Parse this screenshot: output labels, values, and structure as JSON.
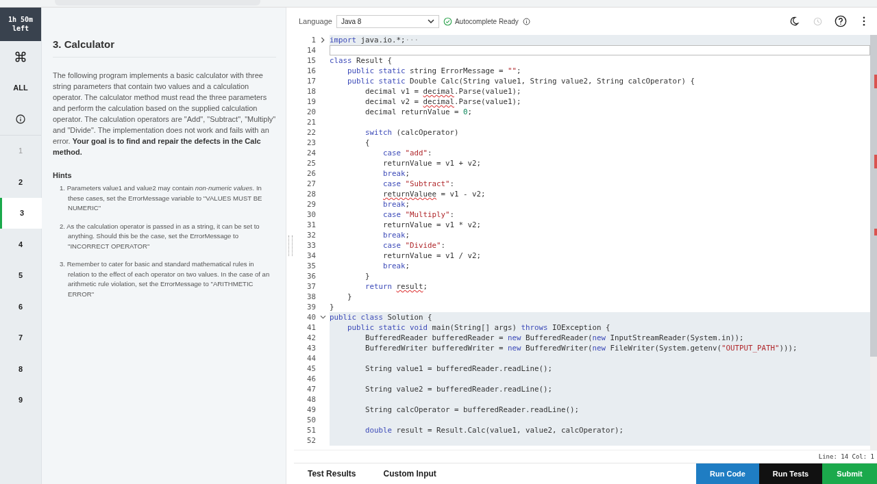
{
  "timer": {
    "text": "1h 50m\nleft"
  },
  "rail": [
    {
      "kind": "command",
      "selected": false
    },
    {
      "kind": "text",
      "label": "ALL",
      "selected": false
    },
    {
      "kind": "info",
      "selected": false
    },
    {
      "kind": "number",
      "label": "1",
      "selected": false,
      "done": true
    },
    {
      "kind": "number",
      "label": "2",
      "selected": false,
      "done": false
    },
    {
      "kind": "number",
      "label": "3",
      "selected": true,
      "done": false
    },
    {
      "kind": "number",
      "label": "4",
      "selected": false,
      "done": false
    },
    {
      "kind": "number",
      "label": "5",
      "selected": false,
      "done": false
    },
    {
      "kind": "number",
      "label": "6",
      "selected": false,
      "done": false
    },
    {
      "kind": "number",
      "label": "7",
      "selected": false,
      "done": false
    },
    {
      "kind": "number",
      "label": "8",
      "selected": false,
      "done": false
    },
    {
      "kind": "number",
      "label": "9",
      "selected": false,
      "done": false
    }
  ],
  "problem": {
    "title": "3. Calculator",
    "description": "The following program implements a basic calculator with three string parameters that contain two values and a calculation operator. The calculator method must read the three parameters and perform the calculation based on the supplied calculation operator. The calculation operators are \"Add\", \"Subtract\", \"Multiply\" and \"Divide\". The implementation does not work and fails with an error. **Your goal is to find and repair the defects in the Calc method.**",
    "hints_heading": "Hints",
    "hints": [
      "1. Parameters value1 and value2 may contain *non-numeric values*. In these cases, set the ErrorMessage variable to \"VALUES MUST BE NUMERIC\"",
      "2. As the calculation operator is passed in as a string, it can be set to anything. Should this be the case, set the ErrorMessage  to \"INCORRECT OPERATOR\"",
      "3. Remember to cater for basic and standard mathematical rules in relation to the effect of each operator on two values. In the case of an arithmetic rule violation, set the ErrorMessage to \"ARITHMETIC ERROR\""
    ]
  },
  "toolbar": {
    "language_label": "Language",
    "language": "Java 8",
    "autocomplete": "Autocomplete Ready"
  },
  "code": [
    {
      "n": "1",
      "collapsed": true,
      "selected": true,
      "current": false,
      "segs": [
        {
          "kind": "kw",
          "t": "import"
        },
        {
          "kind": "plain",
          "t": " java.io.*;"
        },
        {
          "kind": "fold",
          "t": "···"
        }
      ]
    },
    {
      "n": "14",
      "selected": false,
      "current": true
    },
    {
      "n": "15",
      "selected": false,
      "current": false,
      "segs": [
        {
          "kind": "kw",
          "t": "class"
        },
        {
          "kind": "plain",
          "t": " Result {"
        }
      ]
    },
    {
      "n": "16",
      "selected": false,
      "current": false,
      "segs": [
        {
          "kind": "kw",
          "t": "    public static"
        },
        {
          "kind": "plain",
          "t": " string ErrorMessage = "
        },
        {
          "kind": "str",
          "t": "\"\""
        },
        {
          "kind": "plain",
          "t": ";"
        }
      ]
    },
    {
      "n": "17",
      "selected": false,
      "current": false,
      "segs": [
        {
          "kind": "kw",
          "t": "    public static"
        },
        {
          "kind": "plain",
          "t": " Double Calc(String value1, String value2, String calcOperator) {"
        }
      ]
    },
    {
      "n": "18",
      "selected": false,
      "current": false,
      "segs": [
        {
          "kind": "plain",
          "t": "        decimal v1 = "
        },
        {
          "kind": "err",
          "t": "decimal"
        },
        {
          "kind": "plain",
          "t": ".Parse(value1);"
        }
      ]
    },
    {
      "n": "19",
      "selected": false,
      "current": false,
      "segs": [
        {
          "kind": "plain",
          "t": "        decimal v2 = "
        },
        {
          "kind": "err",
          "t": "decimal"
        },
        {
          "kind": "plain",
          "t": ".Parse(value1);"
        }
      ]
    },
    {
      "n": "20",
      "selected": false,
      "current": false,
      "segs": [
        {
          "kind": "plain",
          "t": "        decimal returnValue = "
        },
        {
          "kind": "num",
          "t": "0"
        },
        {
          "kind": "plain",
          "t": ";"
        }
      ]
    },
    {
      "n": "21",
      "selected": false,
      "current": false
    },
    {
      "n": "22",
      "selected": false,
      "current": false,
      "segs": [
        {
          "kind": "kw",
          "t": "        switch"
        },
        {
          "kind": "plain",
          "t": " (calcOperator)"
        }
      ]
    },
    {
      "n": "23",
      "selected": false,
      "current": false,
      "segs": [
        {
          "kind": "plain",
          "t": "        {"
        }
      ]
    },
    {
      "n": "24",
      "selected": false,
      "current": false,
      "segs": [
        {
          "kind": "kw",
          "t": "            case"
        },
        {
          "kind": "str",
          "t": " \"add\""
        },
        {
          "kind": "plain",
          "t": ":"
        }
      ]
    },
    {
      "n": "25",
      "selected": false,
      "current": false,
      "segs": [
        {
          "kind": "plain",
          "t": "            returnValue = v1 + v2;"
        }
      ]
    },
    {
      "n": "26",
      "selected": false,
      "current": false,
      "segs": [
        {
          "kind": "kw",
          "t": "            break"
        },
        {
          "kind": "plain",
          "t": ";"
        }
      ]
    },
    {
      "n": "27",
      "selected": false,
      "current": false,
      "segs": [
        {
          "kind": "kw",
          "t": "            case"
        },
        {
          "kind": "str",
          "t": " \"Subtract\""
        },
        {
          "kind": "plain",
          "t": ":"
        }
      ]
    },
    {
      "n": "28",
      "selected": false,
      "current": false,
      "segs": [
        {
          "kind": "err",
          "t": "            returnValuee"
        },
        {
          "kind": "plain",
          "t": " = v1 - v2;"
        }
      ]
    },
    {
      "n": "29",
      "selected": false,
      "current": false,
      "segs": [
        {
          "kind": "kw",
          "t": "            break"
        },
        {
          "kind": "plain",
          "t": ";"
        }
      ]
    },
    {
      "n": "30",
      "selected": false,
      "current": false,
      "segs": [
        {
          "kind": "kw",
          "t": "            case"
        },
        {
          "kind": "str",
          "t": " \"Multiply\""
        },
        {
          "kind": "plain",
          "t": ":"
        }
      ]
    },
    {
      "n": "31",
      "selected": false,
      "current": false,
      "segs": [
        {
          "kind": "plain",
          "t": "            returnValue = v1 * v2;"
        }
      ]
    },
    {
      "n": "32",
      "selected": false,
      "current": false,
      "segs": [
        {
          "kind": "kw",
          "t": "            break"
        },
        {
          "kind": "plain",
          "t": ";"
        }
      ]
    },
    {
      "n": "33",
      "selected": false,
      "current": false,
      "segs": [
        {
          "kind": "kw",
          "t": "            case"
        },
        {
          "kind": "str",
          "t": " \"Divide\""
        },
        {
          "kind": "plain",
          "t": ":"
        }
      ]
    },
    {
      "n": "34",
      "selected": false,
      "current": false,
      "segs": [
        {
          "kind": "plain",
          "t": "            returnValue = v1 / v2;"
        }
      ]
    },
    {
      "n": "35",
      "selected": false,
      "current": false,
      "segs": [
        {
          "kind": "kw",
          "t": "            break"
        },
        {
          "kind": "plain",
          "t": ";"
        }
      ]
    },
    {
      "n": "36",
      "selected": false,
      "current": false,
      "segs": [
        {
          "kind": "plain",
          "t": "        }"
        }
      ]
    },
    {
      "n": "37",
      "selected": false,
      "current": false,
      "segs": [
        {
          "kind": "kw",
          "t": "        return"
        },
        {
          "kind": "err",
          "t": " result"
        },
        {
          "kind": "plain",
          "t": ";"
        }
      ]
    },
    {
      "n": "38",
      "selected": false,
      "current": false,
      "segs": [
        {
          "kind": "plain",
          "t": "    }"
        }
      ]
    },
    {
      "n": "39",
      "selected": false,
      "current": false,
      "segs": [
        {
          "kind": "plain",
          "t": "}"
        }
      ]
    },
    {
      "n": "40",
      "collapsed": false,
      "selected": true,
      "current": false,
      "segs": [
        {
          "kind": "kw",
          "t": "public class"
        },
        {
          "kind": "plain",
          "t": " Solution {"
        }
      ]
    },
    {
      "n": "41",
      "selected": true,
      "current": false,
      "segs": [
        {
          "kind": "kw",
          "t": "    public static void"
        },
        {
          "kind": "plain",
          "t": " main(String[] args) "
        },
        {
          "kind": "kw",
          "t": "throws"
        },
        {
          "kind": "plain",
          "t": " IOException {"
        }
      ]
    },
    {
      "n": "42",
      "selected": true,
      "current": false,
      "segs": [
        {
          "kind": "plain",
          "t": "        BufferedReader bufferedReader = "
        },
        {
          "kind": "kw",
          "t": "new"
        },
        {
          "kind": "plain",
          "t": " BufferedReader("
        },
        {
          "kind": "kw",
          "t": "new"
        },
        {
          "kind": "plain",
          "t": " InputStreamReader(System.in));"
        }
      ]
    },
    {
      "n": "43",
      "selected": true,
      "current": false,
      "segs": [
        {
          "kind": "plain",
          "t": "        BufferedWriter bufferedWriter = "
        },
        {
          "kind": "kw",
          "t": "new"
        },
        {
          "kind": "plain",
          "t": " BufferedWriter("
        },
        {
          "kind": "kw",
          "t": "new"
        },
        {
          "kind": "plain",
          "t": " FileWriter(System.getenv("
        },
        {
          "kind": "str",
          "t": "\"OUTPUT_PATH\""
        },
        {
          "kind": "plain",
          "t": ")));"
        }
      ]
    },
    {
      "n": "44",
      "selected": true,
      "current": false
    },
    {
      "n": "45",
      "selected": true,
      "current": false,
      "segs": [
        {
          "kind": "plain",
          "t": "        String value1 = bufferedReader.readLine();"
        }
      ]
    },
    {
      "n": "46",
      "selected": true,
      "current": false
    },
    {
      "n": "47",
      "selected": true,
      "current": false,
      "segs": [
        {
          "kind": "plain",
          "t": "        String value2 = bufferedReader.readLine();"
        }
      ]
    },
    {
      "n": "48",
      "selected": true,
      "current": false
    },
    {
      "n": "49",
      "selected": true,
      "current": false,
      "segs": [
        {
          "kind": "plain",
          "t": "        String calcOperator = bufferedReader.readLine();"
        }
      ]
    },
    {
      "n": "50",
      "selected": true,
      "current": false
    },
    {
      "n": "51",
      "selected": true,
      "current": false,
      "segs": [
        {
          "kind": "kw",
          "t": "        double"
        },
        {
          "kind": "plain",
          "t": " result = Result.Calc(value1, value2, calcOperator);"
        }
      ]
    },
    {
      "n": "52",
      "selected": true,
      "current": false
    }
  ],
  "status": "Line: 14 Col: 1",
  "bottom_tabs": [
    {
      "label": "Test Results",
      "selected": false
    },
    {
      "label": "Custom Input",
      "selected": false
    }
  ],
  "actions": [
    {
      "label": "Run Code",
      "kind": "blue"
    },
    {
      "label": "Run Tests",
      "kind": "dark"
    },
    {
      "label": "Submit",
      "kind": "green"
    }
  ]
}
